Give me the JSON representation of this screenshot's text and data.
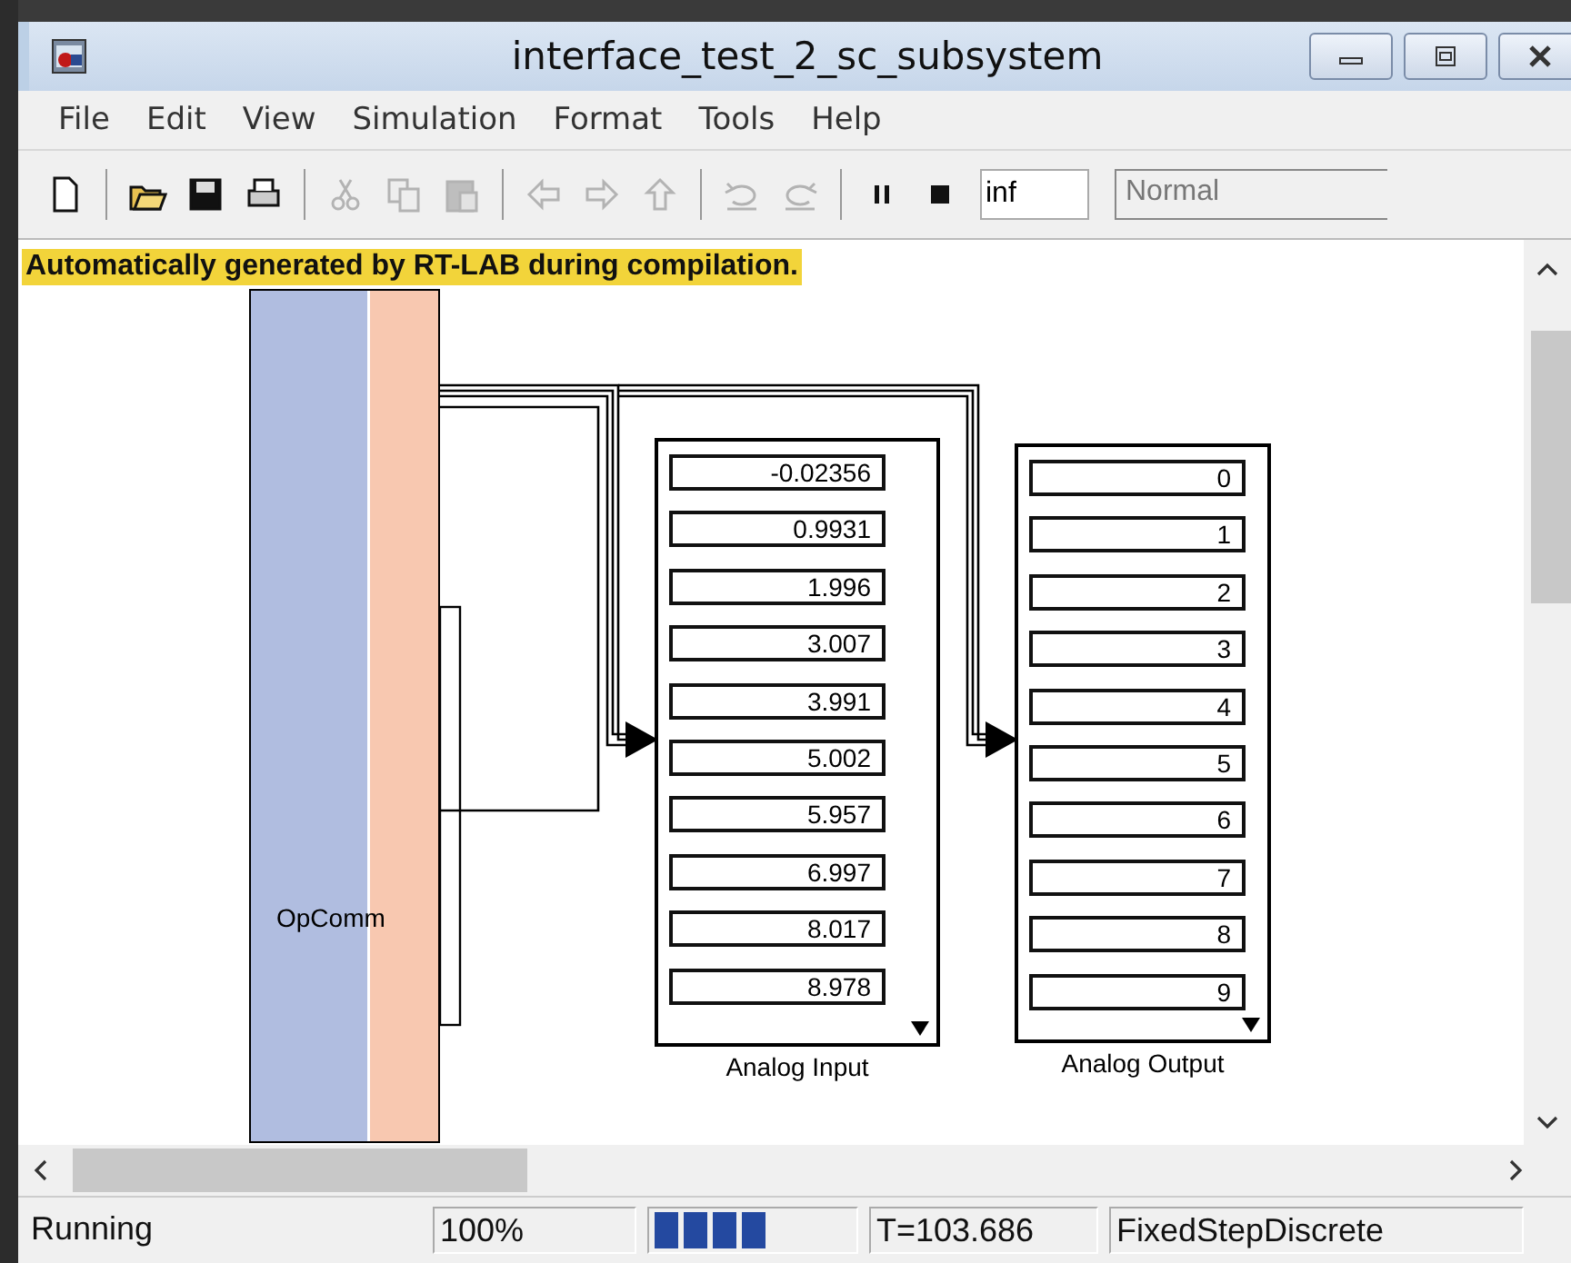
{
  "window": {
    "title": "interface_test_2_sc_subsystem"
  },
  "menu": [
    "File",
    "Edit",
    "View",
    "Simulation",
    "Format",
    "Tools",
    "Help"
  ],
  "toolbar": {
    "buttons": [
      {
        "kind": "new",
        "disabled": false
      },
      {
        "kind": "sep"
      },
      {
        "kind": "open",
        "disabled": false
      },
      {
        "kind": "save",
        "disabled": false
      },
      {
        "kind": "print",
        "disabled": false
      },
      {
        "kind": "sep"
      },
      {
        "kind": "cut",
        "disabled": true
      },
      {
        "kind": "copy",
        "disabled": true
      },
      {
        "kind": "paste",
        "disabled": true
      },
      {
        "kind": "sep"
      },
      {
        "kind": "back",
        "disabled": true
      },
      {
        "kind": "forward",
        "disabled": true
      },
      {
        "kind": "up",
        "disabled": true
      },
      {
        "kind": "sep"
      },
      {
        "kind": "undo",
        "disabled": true
      },
      {
        "kind": "redo",
        "disabled": true
      },
      {
        "kind": "sep"
      },
      {
        "kind": "pause",
        "disabled": false
      },
      {
        "kind": "stop",
        "disabled": false
      }
    ],
    "stop_time": "inf",
    "mode": "Normal"
  },
  "canvas": {
    "banner": "Automatically generated by RT-LAB during compilation.",
    "blocks": [
      {
        "kind": "opcomm",
        "label": "OpComm"
      },
      {
        "kind": "display",
        "label": "Analog Input",
        "values": [
          "-0.02356",
          "0.9931",
          "1.996",
          "3.007",
          "3.991",
          "5.002",
          "5.957",
          "6.997",
          "8.017",
          "8.978"
        ]
      },
      {
        "kind": "display",
        "label": "Analog Output",
        "values": [
          "0",
          "1",
          "2",
          "3",
          "4",
          "5",
          "6",
          "7",
          "8",
          "9"
        ]
      }
    ]
  },
  "status_bar": {
    "state": "Running",
    "zoom": "100%",
    "time": "T=103.686",
    "solver": "FixedStepDiscrete"
  }
}
